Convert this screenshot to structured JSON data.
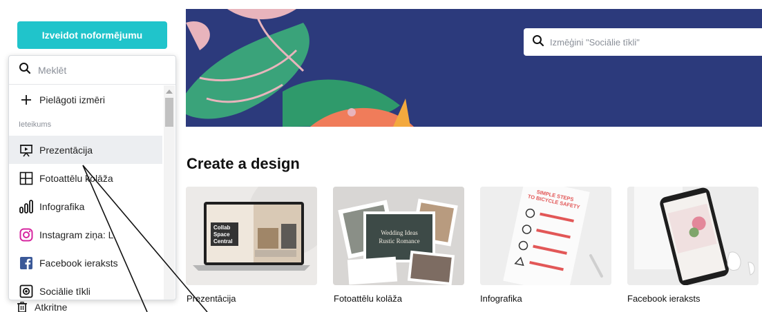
{
  "sidebar": {
    "create_button": "Izveidot noformējumu",
    "search_placeholder": "Meklēt",
    "custom_size": "Pielāgoti izmēri",
    "section_label": "Ieteikums",
    "items": [
      {
        "label": "Prezentācija",
        "icon": "presentation-icon"
      },
      {
        "label": "Fotoattēlu kolāža",
        "icon": "collage-icon"
      },
      {
        "label": "Infografika",
        "icon": "infographic-icon"
      },
      {
        "label": "Instagram ziņa: L",
        "icon": "instagram-icon"
      },
      {
        "label": "Facebook ieraksts",
        "icon": "facebook-icon"
      },
      {
        "label": "Sociālie tīkli",
        "icon": "social-icon"
      }
    ],
    "trash_label": "Atkritne"
  },
  "hero": {
    "search_placeholder": "Izmēģini \"Sociālie tīkli\""
  },
  "main": {
    "section_title": "Create a design",
    "cards": [
      {
        "label": "Prezentācija"
      },
      {
        "label": "Fotoattēlu kolāža"
      },
      {
        "label": "Infografika"
      },
      {
        "label": "Facebook ieraksts"
      }
    ],
    "thumb_text": {
      "laptop": "Collab Space Central",
      "collage": "Wedding Ideas Rustic Romance",
      "infographic": "SIMPLE STEPS TO BICYCLE SAFETY"
    }
  },
  "colors": {
    "accent": "#20c4cb",
    "hero_bg": "#2c3a7c",
    "instagram": "#d6249f",
    "facebook": "#3b5998"
  }
}
